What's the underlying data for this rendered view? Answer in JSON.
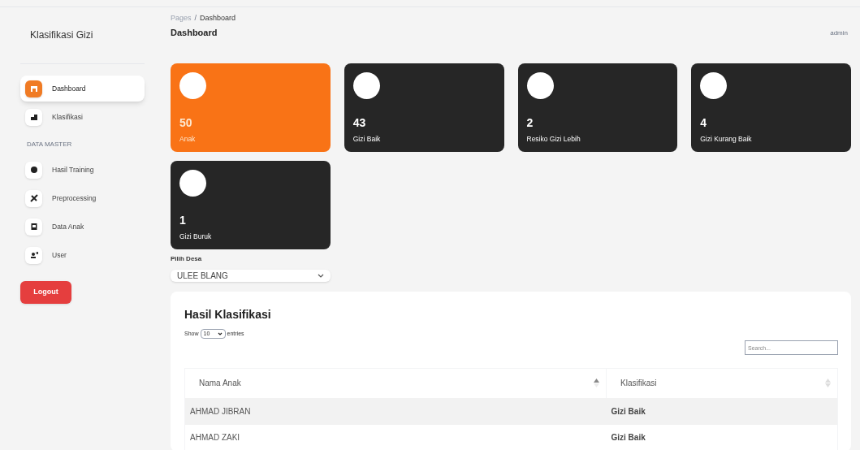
{
  "sidebar": {
    "brand": "Klasifikasi Gizi",
    "items": [
      {
        "kind": "item",
        "label": "Dashboard",
        "selected": true
      },
      {
        "kind": "item",
        "label": "Klasifikasi",
        "selected": false
      },
      {
        "kind": "heading",
        "label": "DATA MASTER"
      },
      {
        "kind": "item",
        "label": "Hasil Training",
        "selected": false
      },
      {
        "kind": "item",
        "label": "Preprocessing",
        "selected": false
      },
      {
        "kind": "item",
        "label": "Data Anak",
        "selected": false
      },
      {
        "kind": "item",
        "label": "User",
        "selected": false
      }
    ],
    "logout": "Logout"
  },
  "header": {
    "breadcrumb": [
      "Pages",
      "Dashboard"
    ],
    "breadcrumb_separator": "/",
    "title": "Dashboard",
    "user": "admin"
  },
  "stats": [
    {
      "value": "50",
      "label": "Anak",
      "highlighted": true
    },
    {
      "value": "43",
      "label": "Gizi Baik",
      "highlighted": false
    },
    {
      "value": "2",
      "label": "Resiko Gizi Lebih",
      "highlighted": false
    },
    {
      "value": "4",
      "label": "Gizi Kurang Baik",
      "highlighted": false
    },
    {
      "value": "1",
      "label": "Gizi Buruk",
      "highlighted": false
    }
  ],
  "village_select": {
    "label": "Pilih Desa",
    "value": "ULEE BLANG"
  },
  "table": {
    "title": "Hasil Klasifikasi",
    "show_label": "Show",
    "page_size": "10",
    "entries_label": "entries",
    "search_placeholder": "Search...",
    "columns": [
      {
        "label": "Nama Anak",
        "sorted": true
      },
      {
        "label": "Klasifikasi",
        "sorted": false
      }
    ],
    "rows": [
      [
        "AHMAD JIBRAN",
        "Gizi Baik"
      ],
      [
        "AHMAD ZAKI",
        "Gizi Baik"
      ]
    ]
  }
}
